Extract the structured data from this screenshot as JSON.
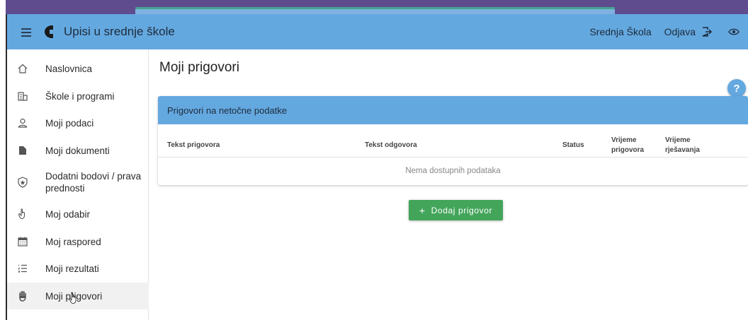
{
  "app": {
    "title": "Upisi u srednje škole",
    "school_label": "Srednja Škola",
    "logout_label": "Odjava",
    "accent_color": "#64a8e0"
  },
  "sidebar": {
    "items": [
      {
        "label": "Naslovnica",
        "icon": "home-icon"
      },
      {
        "label": "Škole i programi",
        "icon": "building-icon"
      },
      {
        "label": "Moji podaci",
        "icon": "person-icon"
      },
      {
        "label": "Moji dokumenti",
        "icon": "document-icon"
      },
      {
        "label": "Dodatni bodovi / prava prednosti",
        "icon": "shield-star-icon"
      },
      {
        "label": "Moj odabir",
        "icon": "hand-pointer-icon"
      },
      {
        "label": "Moj raspored",
        "icon": "calendar-icon"
      },
      {
        "label": "Moji rezultati",
        "icon": "list-numbered-icon"
      },
      {
        "label": "Moji prigovori",
        "icon": "hand-icon",
        "active": true
      }
    ]
  },
  "main": {
    "page_title": "Moji prigovori",
    "help_label": "?",
    "card": {
      "title": "Prigovori na netočne podatke",
      "columns": [
        "Tekst prigovora",
        "Tekst odgovora",
        "Status",
        "Vrijeme prigovora",
        "Vrijeme rješavanja"
      ],
      "empty_text": "Nema dostupnih podataka"
    },
    "add_button": {
      "plus": "+",
      "label": "Dodaj prigovor"
    }
  }
}
